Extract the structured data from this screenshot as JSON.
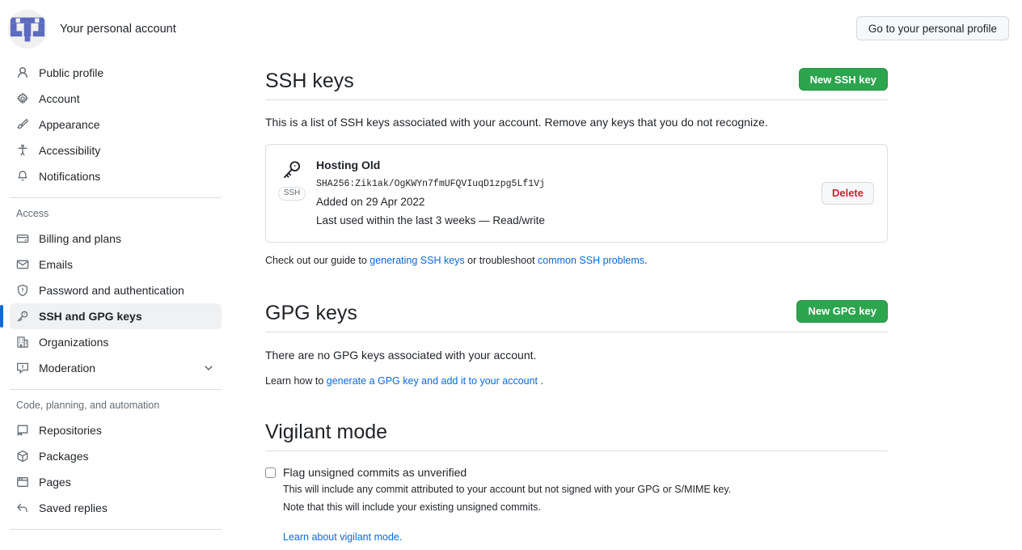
{
  "account": {
    "label": "Your personal account",
    "avatar_icon": "identicon-avatar",
    "avatar_color": "#5c6bc0"
  },
  "header": {
    "profile_button": "Go to your personal profile"
  },
  "sidebar": {
    "primary_items": [
      {
        "label": "Public profile",
        "icon": "person-icon"
      },
      {
        "label": "Account",
        "icon": "gear-icon"
      },
      {
        "label": "Appearance",
        "icon": "paintbrush-icon"
      },
      {
        "label": "Accessibility",
        "icon": "accessibility-icon"
      },
      {
        "label": "Notifications",
        "icon": "bell-icon"
      }
    ],
    "groups": [
      {
        "title": "Access",
        "items": [
          {
            "label": "Billing and plans",
            "icon": "credit-card-icon",
            "active": false,
            "chevron": false
          },
          {
            "label": "Emails",
            "icon": "mail-icon",
            "active": false,
            "chevron": false
          },
          {
            "label": "Password and authentication",
            "icon": "shield-icon",
            "active": false,
            "chevron": false
          },
          {
            "label": "SSH and GPG keys",
            "icon": "key-icon",
            "active": true,
            "chevron": false
          },
          {
            "label": "Organizations",
            "icon": "organization-icon",
            "active": false,
            "chevron": false
          },
          {
            "label": "Moderation",
            "icon": "report-icon",
            "active": false,
            "chevron": true
          }
        ]
      },
      {
        "title": "Code, planning, and automation",
        "items": [
          {
            "label": "Repositories",
            "icon": "repo-icon",
            "active": false,
            "chevron": false
          },
          {
            "label": "Packages",
            "icon": "package-icon",
            "active": false,
            "chevron": false
          },
          {
            "label": "Pages",
            "icon": "browser-icon",
            "active": false,
            "chevron": false
          },
          {
            "label": "Saved replies",
            "icon": "reply-icon",
            "active": false,
            "chevron": false
          }
        ]
      }
    ]
  },
  "ssh_section": {
    "title": "SSH keys",
    "new_button": "New SSH key",
    "description": "This is a list of SSH keys associated with your account. Remove any keys that you do not recognize.",
    "key": {
      "title": "Hosting Old",
      "badge": "SSH",
      "fingerprint": "SHA256:Zik1ak/OgKWYn7fmUFQVIuqD1zpg5Lf1Vj",
      "added": "Added on 29 Apr 2022",
      "last_used": "Last used within the last 3 weeks — Read/write",
      "delete_button": "Delete"
    },
    "footer": {
      "prefix": "Check out our guide to ",
      "link1": "generating SSH keys",
      "middle": " or troubleshoot ",
      "link2": "common SSH problems",
      "suffix": "."
    }
  },
  "gpg_section": {
    "title": "GPG keys",
    "new_button": "New GPG key",
    "empty_text": "There are no GPG keys associated with your account.",
    "learn_prefix": "Learn how to ",
    "learn_link": "generate a GPG key and add it to your account",
    "learn_suffix": " ."
  },
  "vigilant_section": {
    "title": "Vigilant mode",
    "checkbox_label": "Flag unsigned commits as unverified",
    "checkbox_checked": false,
    "sub_line1": "This will include any commit attributed to your account but not signed with your GPG or S/MIME key.",
    "sub_line2": "Note that this will include your existing unsigned commits.",
    "learn_link": "Learn about vigilant mode."
  },
  "colors": {
    "accent": "#0969da",
    "green": "#2da44e",
    "danger": "#cf222e",
    "border": "#d8dee4"
  }
}
